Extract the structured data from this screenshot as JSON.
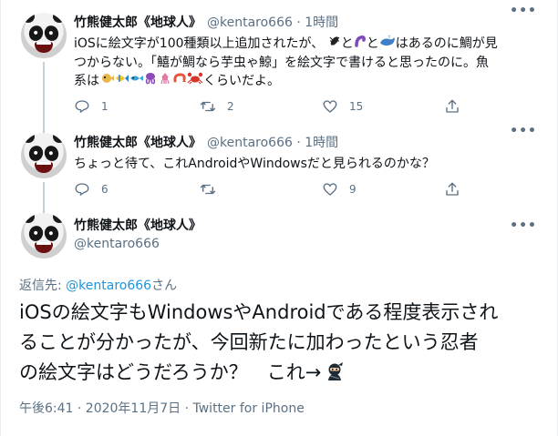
{
  "tweet1": {
    "display_name": "竹熊健太郎《地球人》",
    "handle_time": "@kentaro666 · 1時間",
    "text_line1": "iOSに絵文字が100種類以上追加されたが、",
    "text_line1b": "と",
    "text_line1c": "と",
    "text_line1d": "はあるのに鯛が見",
    "text_line2": "つからない。「鱚が鯛なら芋虫ゃ鯨」を絵文字で書けると思ったのに。魚",
    "text_line3a": "系は",
    "text_line3b": "くらいだよ。",
    "emoji_line1": [
      "black-bug",
      "purple-worm",
      "whale"
    ],
    "emoji_line3": [
      "blowfish",
      "tropical-fish",
      "fish",
      "octopus",
      "squid",
      "shrimp",
      "crab"
    ],
    "replies": "1",
    "retweets": "2",
    "likes": "15"
  },
  "tweet2": {
    "display_name": "竹熊健太郎《地球人》",
    "handle_time": "@kentaro666 · 1時間",
    "text": "ちょっと待て、これAndroidやWindowsだと見られるのかな？",
    "replies": "6",
    "retweets": "",
    "likes": "9"
  },
  "main_tweet": {
    "display_name": "竹熊健太郎《地球人》",
    "handle": "@kentaro666",
    "reply_to_prefix": "返信先: ",
    "reply_to_handle": "@kentaro666",
    "reply_to_suffix": "さん",
    "line1": "iOSの絵文字もWindowsやAndroidである程度表示され",
    "line2": "ることが分かったが、今回新たに加わったという忍者",
    "line3": "の絵文字はどうだろうか？　これ→",
    "timestamp": "午後6:41 · 2020年11月7日 · Twitter for iPhone"
  },
  "more_label": "•••",
  "colors": {
    "text": "#0f1419",
    "secondary": "#5b7083",
    "link": "#1b95e0",
    "divider": "#e6ecf0"
  }
}
